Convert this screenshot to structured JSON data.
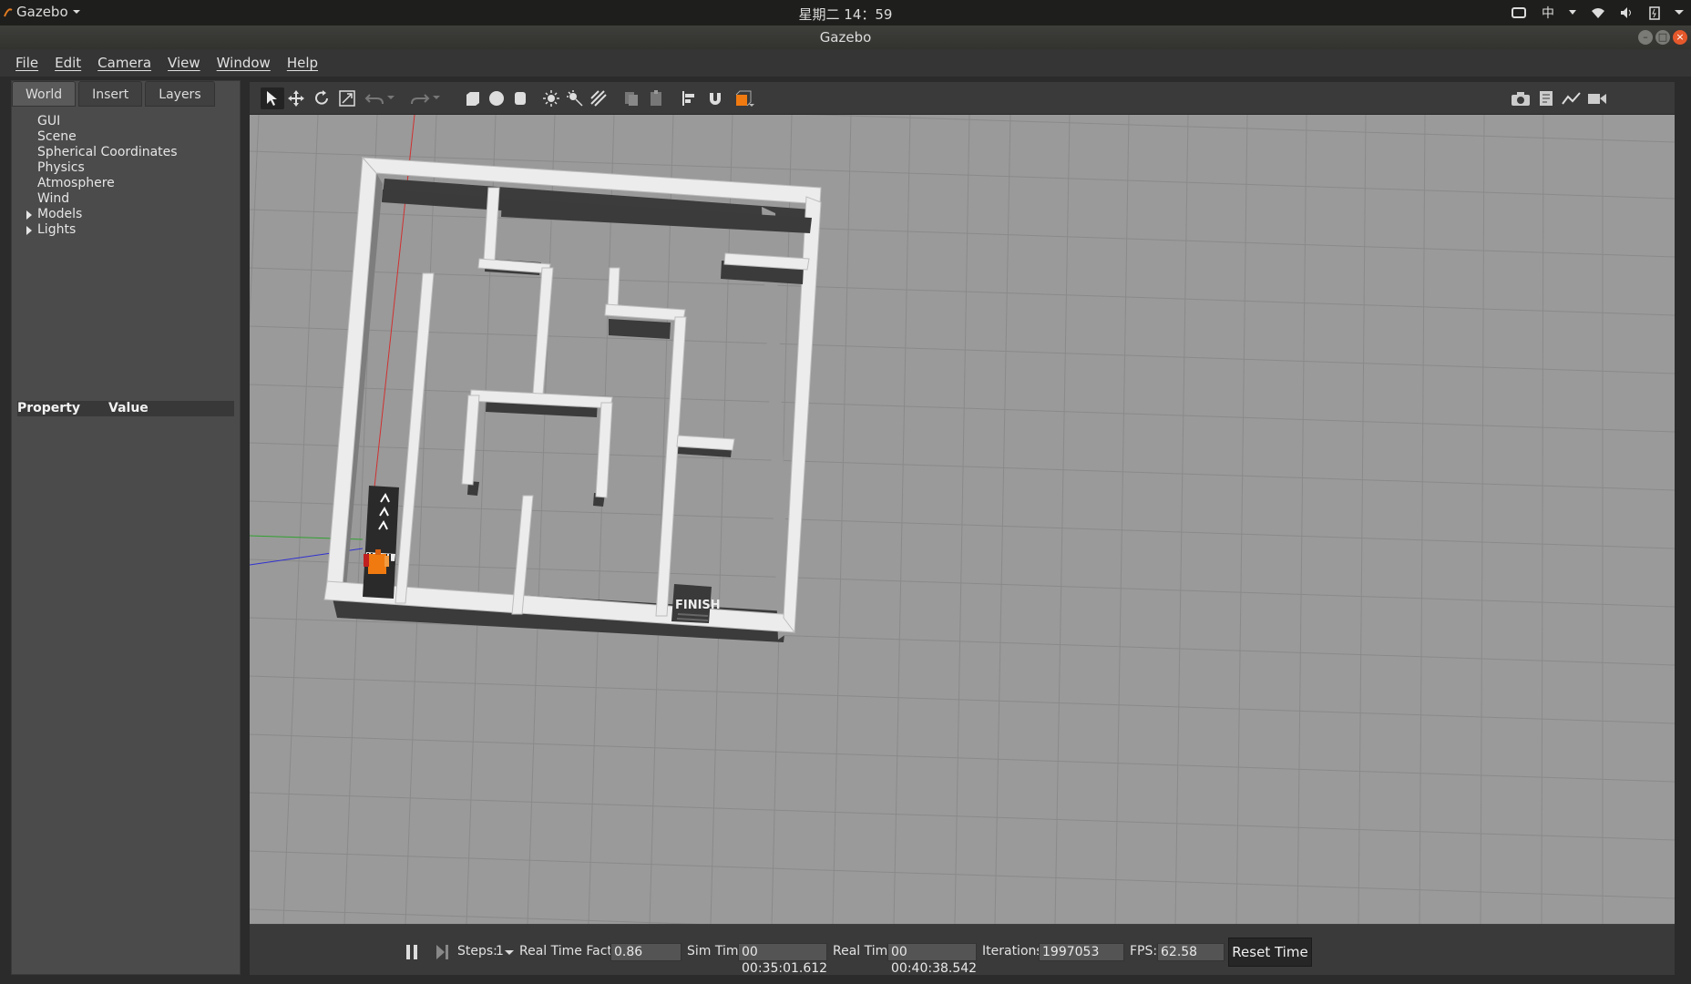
{
  "system": {
    "app_name": "Gazebo",
    "clock": "星期二 14：59",
    "ime": "中"
  },
  "window": {
    "title": "Gazebo"
  },
  "menu": [
    "File",
    "Edit",
    "Camera",
    "View",
    "Window",
    "Help"
  ],
  "left_panel": {
    "tabs": [
      "World",
      "Insert",
      "Layers"
    ],
    "active_tab": "World",
    "tree": [
      {
        "label": "GUI",
        "expandable": false
      },
      {
        "label": "Scene",
        "expandable": false
      },
      {
        "label": "Spherical Coordinates",
        "expandable": false
      },
      {
        "label": "Physics",
        "expandable": false
      },
      {
        "label": "Atmosphere",
        "expandable": false
      },
      {
        "label": "Wind",
        "expandable": false
      },
      {
        "label": "Models",
        "expandable": true
      },
      {
        "label": "Lights",
        "expandable": true
      }
    ],
    "property_header": {
      "property": "Property",
      "value": "Value"
    }
  },
  "toolbar": {
    "tools": [
      "select-tool",
      "translate-tool",
      "rotate-tool",
      "scale-tool",
      "undo",
      "redo",
      "box-shape",
      "sphere-shape",
      "cylinder-shape",
      "point-light",
      "spot-light",
      "directional-light",
      "copy",
      "paste",
      "align",
      "snap",
      "view-angle"
    ],
    "right_tools": [
      "screenshot",
      "log",
      "plot",
      "record-video"
    ]
  },
  "scene": {
    "finish_label": "FINISH",
    "colors": {
      "ground": "#9a9a9a",
      "wall_top": "#ececec",
      "wall_shadow": "#3c3c3c",
      "robot": "#f07a10"
    }
  },
  "bottom_bar": {
    "steps_label": "Steps:",
    "steps_value": "1",
    "rtf_label": "Real Time Factor:",
    "rtf_value": "0.86",
    "sim_time_label": "Sim Time:",
    "sim_time_value": "00 00:35:01.612",
    "real_time_label": "Real Time:",
    "real_time_value": "00 00:40:38.542",
    "iterations_label": "Iterations:",
    "iterations_value": "1997053",
    "fps_label": "FPS:",
    "fps_value": "62.58",
    "reset_label": "Reset Time"
  }
}
